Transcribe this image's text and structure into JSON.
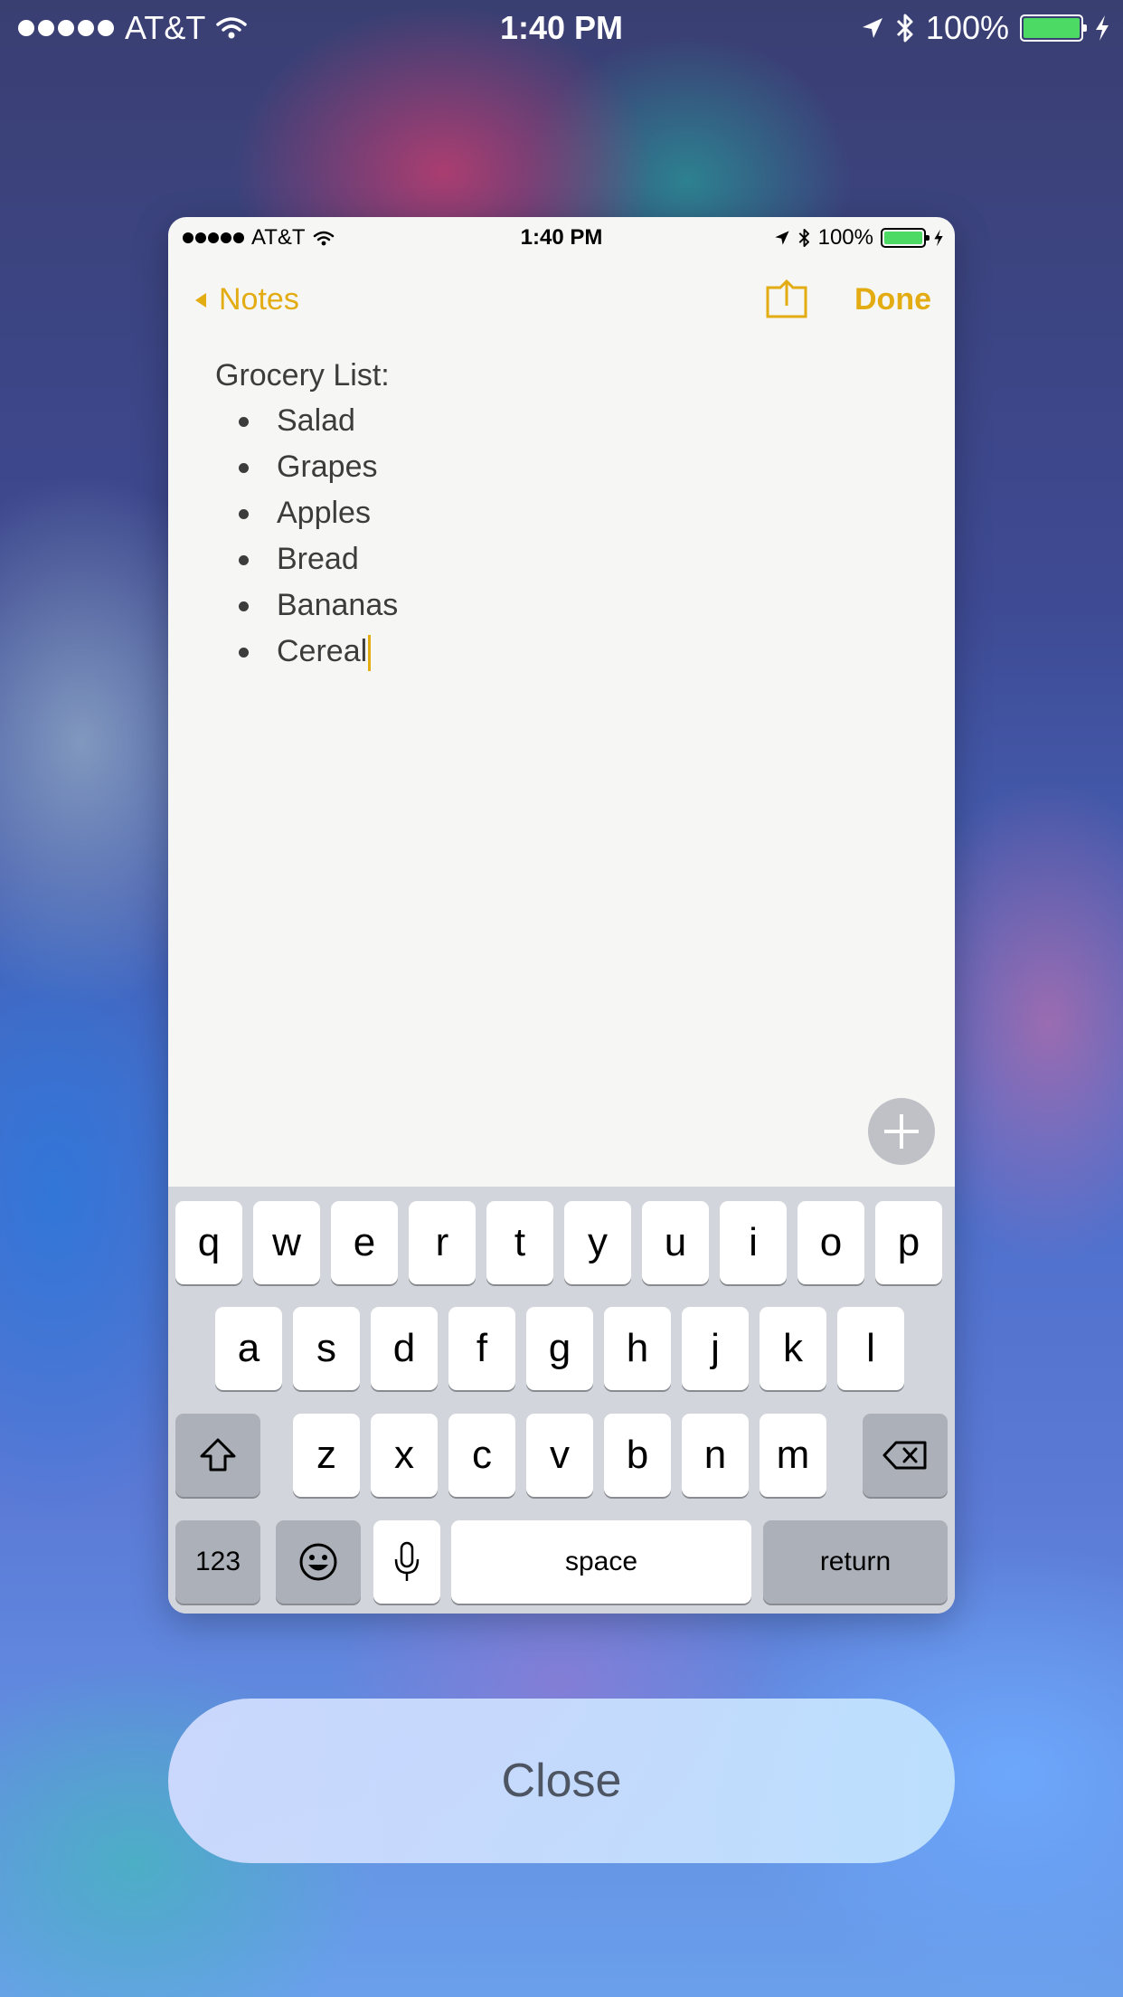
{
  "status_bar": {
    "carrier": "AT&T",
    "time": "1:40 PM",
    "battery": "100%",
    "signal_icon": "signal-dots-icon",
    "wifi_icon": "wifi-icon",
    "location_icon": "location-arrow-icon",
    "bluetooth_icon": "bluetooth-icon",
    "charging_icon": "charging-bolt-icon"
  },
  "preview": {
    "status_bar": {
      "carrier": "AT&T",
      "time": "1:40 PM",
      "battery": "100%"
    },
    "nav": {
      "back_label": "Notes",
      "share_icon": "share-icon",
      "done_label": "Done"
    },
    "note": {
      "title": "Grocery List:",
      "items": [
        "Salad",
        "Grapes",
        "Apples",
        "Bread",
        "Bananas",
        "Cereal"
      ]
    },
    "add_icon": "plus-icon",
    "accent_color": "#e3ac12",
    "keyboard": {
      "row1": [
        "q",
        "w",
        "e",
        "r",
        "t",
        "y",
        "u",
        "i",
        "o",
        "p"
      ],
      "row2": [
        "a",
        "s",
        "d",
        "f",
        "g",
        "h",
        "j",
        "k",
        "l"
      ],
      "row3": [
        "z",
        "x",
        "c",
        "v",
        "b",
        "n",
        "m"
      ],
      "numbers_label": "123",
      "space_label": "space",
      "return_label": "return",
      "shift_icon": "shift-icon",
      "delete_icon": "delete-icon",
      "emoji_icon": "emoji-icon",
      "mic_icon": "microphone-icon"
    }
  },
  "close_label": "Close"
}
